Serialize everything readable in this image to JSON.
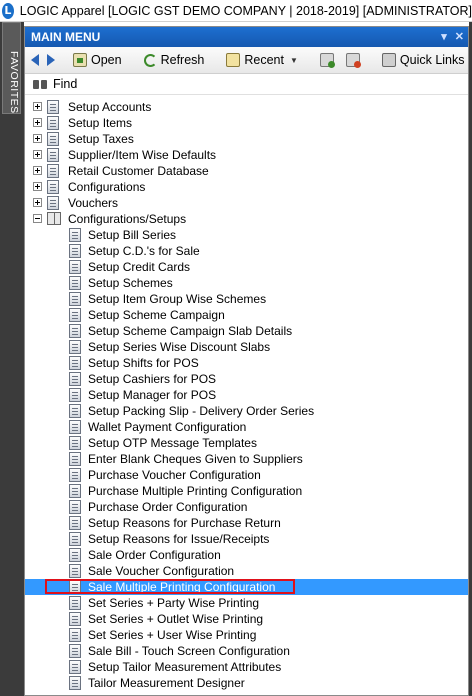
{
  "window": {
    "title": "LOGIC Apparel [LOGIC GST DEMO COMPANY | 2018-2019] [ADMINISTRATOR]",
    "logo_letter": "L"
  },
  "sidebar": {
    "favorites_label": "FAVORITES"
  },
  "panel": {
    "header": "MAIN MENU",
    "pin_glyph": "▾",
    "close_glyph": "✕"
  },
  "toolbar": {
    "open_label": "Open",
    "refresh_label": "Refresh",
    "recent_label": "Recent",
    "quick_links_label": "Quick Links",
    "dropdown_glyph": "▼"
  },
  "find": {
    "label": "Find"
  },
  "tree": {
    "top_items": [
      "Setup Accounts",
      "Setup Items",
      "Setup Taxes",
      "Supplier/Item Wise Defaults",
      "Retail Customer Database",
      "Configurations",
      "Vouchers"
    ],
    "expanded_group": "Configurations/Setups",
    "children": [
      "Setup Bill Series",
      "Setup C.D.'s for Sale",
      "Setup Credit Cards",
      "Setup Schemes",
      "Setup Item Group Wise Schemes",
      "Setup Scheme Campaign",
      "Setup Scheme Campaign Slab Details",
      "Setup Series Wise Discount Slabs",
      "Setup Shifts for POS",
      "Setup Cashiers for POS",
      "Setup Manager for POS",
      "Setup Packing Slip - Delivery Order Series",
      "Wallet Payment Configuration",
      "Setup OTP Message Templates",
      "Enter Blank Cheques Given to Suppliers",
      "Purchase Voucher Configuration",
      "Purchase Multiple Printing Configuration",
      "Purchase Order Configuration",
      "Setup Reasons for Purchase Return",
      "Setup Reasons for Issue/Receipts",
      "Sale Order Configuration",
      "Sale Voucher Configuration",
      "Sale Multiple Printing Configuration",
      "Set Series + Party Wise Printing",
      "Set Series + Outlet Wise Printing",
      "Set Series + User Wise Printing",
      "Sale Bill - Touch Screen Configuration",
      "Setup Tailor Measurement Attributes",
      "Tailor Measurement Designer"
    ],
    "selected_child": "Sale Multiple Printing Configuration"
  },
  "colors": {
    "header_blue": "#1d6fd0",
    "selection_blue": "#3399ff",
    "highlight_red": "#e0101a",
    "chrome_dark": "#3b3b3b"
  }
}
